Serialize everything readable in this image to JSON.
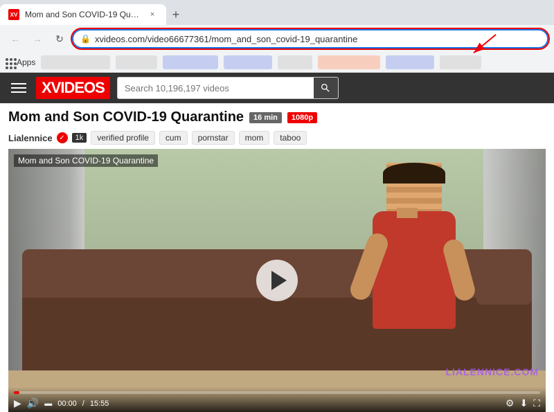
{
  "browser": {
    "tab": {
      "title": "Mom and Son COVID-19 Qua...",
      "favicon_label": "XV"
    },
    "new_tab_icon": "+",
    "nav": {
      "back": "←",
      "forward": "→",
      "refresh": "↻"
    },
    "address_bar": {
      "lock_icon": "🔒",
      "url": "xvideos.com/video66677361/mom_and_son_covid-19_quarantine"
    },
    "bookmarks": {
      "apps_label": "Apps"
    }
  },
  "site": {
    "logo": "XVIDEOS",
    "search_placeholder": "Search 10,196,197 videos"
  },
  "video": {
    "title": "Mom and Son COVID-19 Quarantine",
    "duration": "16 min",
    "quality": "1080p",
    "title_overlay": "Mom and Son COVID-19 Quarantine",
    "channel": "Lialennice",
    "verified": "✓",
    "subscribers": "1k",
    "tags": [
      "verified profile",
      "cum",
      "pornstar",
      "mom",
      "taboo"
    ],
    "time_current": "00:00",
    "time_total": "15:55",
    "watermark": "LIALENNICE.COM"
  },
  "controls": {
    "play": "▶",
    "volume": "🔊",
    "settings_icon": "⚙",
    "download_icon": "⬇",
    "fullscreen_icon": "⛶"
  }
}
